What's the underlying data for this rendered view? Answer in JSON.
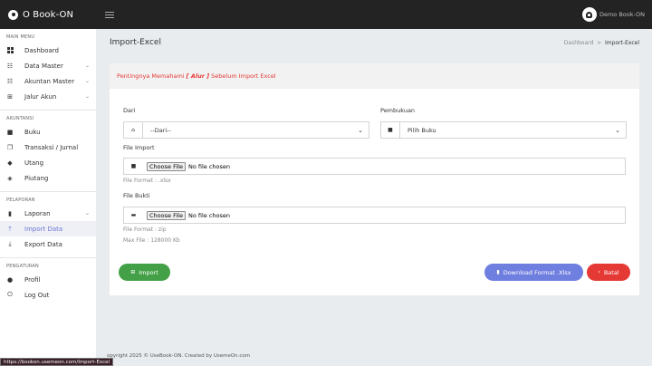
{
  "app": {
    "brand_name": "O Book-ON",
    "user_name": "Demo Book-ON"
  },
  "sidebar": {
    "sections": [
      {
        "title": "MAIN MENU",
        "items": [
          {
            "label": "Dashboard",
            "icon": "grid-icon",
            "chevron": false
          },
          {
            "label": "Data Master",
            "icon": "list-icon",
            "chevron": true
          },
          {
            "label": "Akuntan Master",
            "icon": "list-icon",
            "chevron": true
          },
          {
            "label": "Jalur Akun",
            "icon": "table-icon",
            "chevron": true
          }
        ]
      },
      {
        "title": "AKUNTANSI",
        "items": [
          {
            "label": "Buku",
            "icon": "book-icon",
            "chevron": false
          },
          {
            "label": "Transaksi / Jurnal",
            "icon": "copy-icon",
            "chevron": false
          },
          {
            "label": "Utang",
            "icon": "tag-icon",
            "chevron": false
          },
          {
            "label": "Piutang",
            "icon": "tags-icon",
            "chevron": false
          }
        ]
      },
      {
        "title": "PELAPORAN",
        "items": [
          {
            "label": "Laporan",
            "icon": "file-icon",
            "chevron": true
          },
          {
            "label": "Import Data",
            "icon": "upload-icon",
            "chevron": false,
            "active": true
          },
          {
            "label": "Export Data",
            "icon": "download-icon",
            "chevron": false
          }
        ]
      },
      {
        "title": "PENGATURAN",
        "items": [
          {
            "label": "Profil",
            "icon": "user-icon",
            "chevron": false
          },
          {
            "label": "Log Out",
            "icon": "power-icon",
            "chevron": false
          }
        ]
      }
    ]
  },
  "page": {
    "title": "Import-Excel",
    "breadcrumb_home": "Dashboard",
    "breadcrumb_sep": ">",
    "breadcrumb_current": "Import-Excel"
  },
  "card": {
    "notice_before": "Pentingnya Memahami",
    "notice_bold": "[ Alur ]",
    "notice_after": "Sebelum Import Excel"
  },
  "form": {
    "dari_label": "Dari",
    "dari_value": "--Dari--",
    "pembukuan_label": "Pembukuan",
    "pembukuan_value": "Pilih Buku",
    "file_import_label": "File Import",
    "file_import_btn": "Choose File",
    "file_import_status": "No file chosen",
    "file_import_hint": "File Format : .xlsx",
    "file_bukti_label": "File Bukti",
    "file_bukti_btn": "Choose File",
    "file_bukti_status": "No file chosen",
    "file_bukti_hint1": "File Format : zip",
    "file_bukti_hint2": "Max File : 128000 Kb"
  },
  "buttons": {
    "import": "Import",
    "download": "Download Format .Xlsx",
    "batal": "Batal"
  },
  "footer": {
    "text": "opyright 2025 © UseBook-ON. Created by UsemeOn.com"
  },
  "status_url": "https://bookon.usemeon.com/Import-Excel",
  "colors": {
    "topbar": "#232323",
    "active": "#6e77d3",
    "import": "#43a047",
    "download": "#6f7fe0",
    "batal": "#e53935"
  }
}
